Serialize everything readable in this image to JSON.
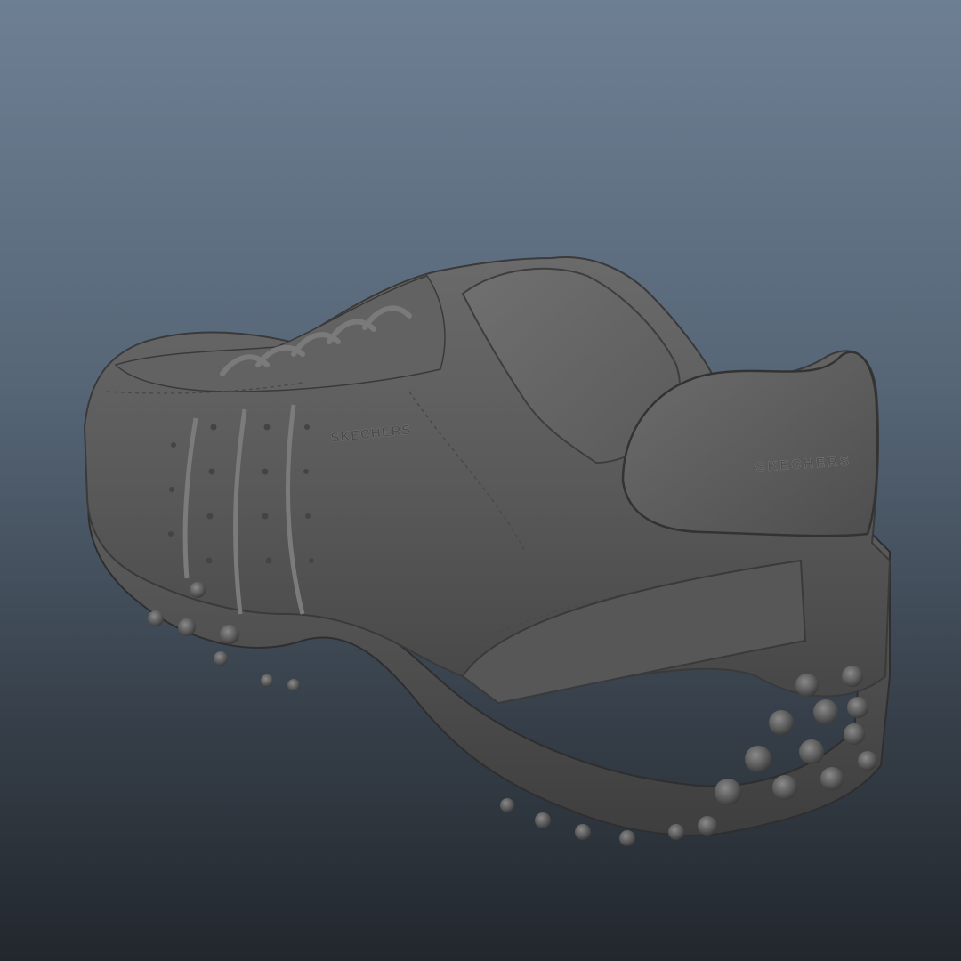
{
  "viewport": {
    "background_top": "#6d7f93",
    "background_bottom": "#22272d"
  },
  "model": {
    "subject": "sneaker-sculpt",
    "material_color": "#5c5c5c",
    "brand_emboss_text": "SKECHERS"
  }
}
